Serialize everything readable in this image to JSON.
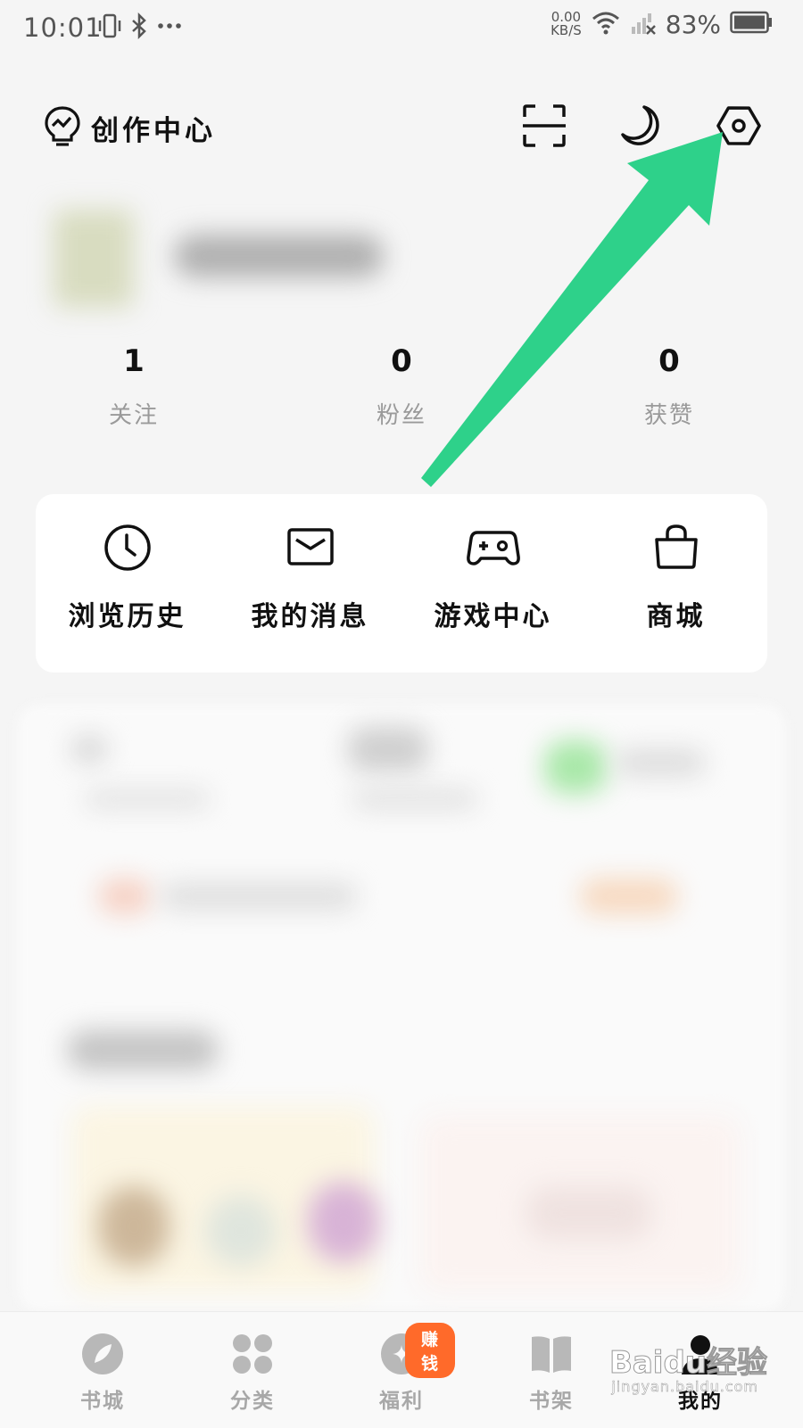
{
  "status_bar": {
    "time": "10:01",
    "speed_value": "0.00",
    "speed_unit": "KB/S",
    "battery": "83%",
    "icons": [
      "vibrate-icon",
      "bluetooth-icon",
      "more-dots-icon",
      "wifi-icon",
      "signal-icon",
      "battery-icon"
    ]
  },
  "header": {
    "creation_label": "创作中心",
    "icons": [
      "lightbulb-chart-icon",
      "scan-icon",
      "moon-icon",
      "settings-icon"
    ]
  },
  "stats": [
    {
      "value": "1",
      "label": "关注"
    },
    {
      "value": "0",
      "label": "粉丝"
    },
    {
      "value": "0",
      "label": "获赞"
    }
  ],
  "quick_actions": [
    {
      "label": "浏览历史",
      "icon": "clock-icon"
    },
    {
      "label": "我的消息",
      "icon": "mail-icon"
    },
    {
      "label": "游戏中心",
      "icon": "gamepad-icon"
    },
    {
      "label": "商城",
      "icon": "shopping-bag-icon"
    }
  ],
  "bottom_nav": [
    {
      "label": "书城",
      "icon": "compass-icon"
    },
    {
      "label": "分类",
      "icon": "grid-icon"
    },
    {
      "label": "福利",
      "icon": "coin-icon",
      "badge": "赚钱"
    },
    {
      "label": "书架",
      "icon": "book-icon"
    },
    {
      "label": "我的",
      "icon": "user-icon",
      "active": true
    }
  ],
  "watermark": {
    "brand": "Baidu经验",
    "url": "jingyan.baidu.com"
  },
  "colors": {
    "arrow": "#2ed18a",
    "badge": "#ff6a2a",
    "inactive_nav": "#a8a8a8"
  }
}
